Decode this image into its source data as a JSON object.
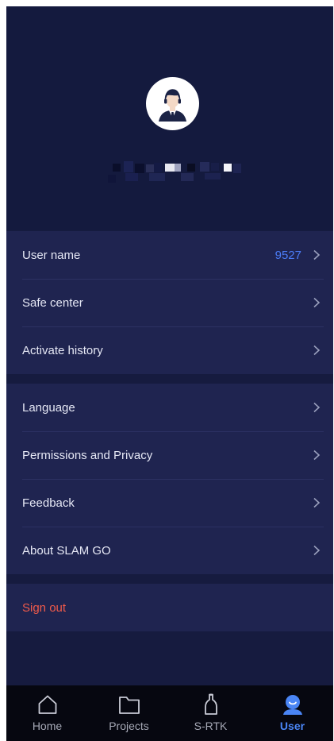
{
  "profile": {
    "avatar_icon": "user-avatar-icon"
  },
  "account_group": {
    "items": [
      {
        "label": "User name",
        "value": "9527"
      },
      {
        "label": "Safe center"
      },
      {
        "label": "Activate history"
      }
    ]
  },
  "settings_group": {
    "items": [
      {
        "label": "Language"
      },
      {
        "label": "Permissions and Privacy"
      },
      {
        "label": "Feedback"
      },
      {
        "label": "About SLAM GO"
      }
    ]
  },
  "signout": {
    "label": "Sign out"
  },
  "tabbar": {
    "tabs": [
      {
        "label": "Home",
        "icon": "home-icon"
      },
      {
        "label": "Projects",
        "icon": "folder-icon"
      },
      {
        "label": "S-RTK",
        "icon": "rtk-device-icon"
      },
      {
        "label": "User",
        "icon": "user-icon",
        "active": true
      }
    ]
  },
  "colors": {
    "background": "#161b3f",
    "header": "#141a3e",
    "row": "#1f2450",
    "accent": "#4a85f5",
    "danger": "#f05a4a",
    "tabbar": "#060710"
  }
}
